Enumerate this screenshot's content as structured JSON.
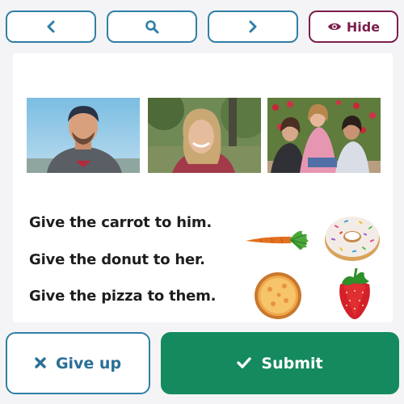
{
  "nav": {
    "back_icon": "chevron-left-icon",
    "search_icon": "search-icon",
    "forward_icon": "chevron-right-icon",
    "hide_label": "Hide",
    "hide_icon": "eye-icon"
  },
  "exercise": {
    "sentences": [
      "Give the carrot to him.",
      "Give the donut to her.",
      "Give the pizza to them."
    ]
  },
  "actions": {
    "give_up_label": "Give up",
    "give_up_icon": "x-icon",
    "submit_label": "Submit",
    "submit_icon": "check-icon"
  },
  "colors": {
    "primary_blue": "#2f7fa6",
    "hide_maroon": "#7a1f4d",
    "submit_green": "#148a5e"
  }
}
